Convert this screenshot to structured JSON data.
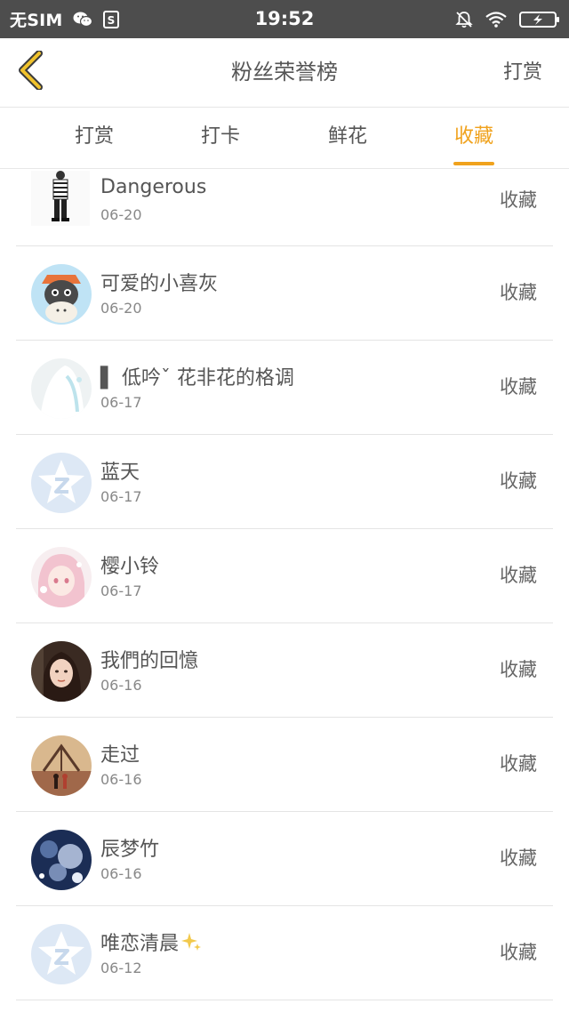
{
  "status_bar": {
    "carrier": "无SIM",
    "time": "19:52",
    "icons": [
      "wechat-icon",
      "s-app-icon",
      "mute-bell-icon",
      "wifi-icon",
      "battery-charging-icon"
    ]
  },
  "header": {
    "title": "粉丝荣誉榜",
    "back_icon": "chevron-left-icon",
    "action_label": "打赏"
  },
  "tabs": [
    {
      "label": "打赏",
      "active": false
    },
    {
      "label": "打卡",
      "active": false
    },
    {
      "label": "鲜花",
      "active": false
    },
    {
      "label": "收藏",
      "active": true
    }
  ],
  "accent_color": "#f0a21d",
  "list": [
    {
      "name": "Dangerous",
      "date": "06-20",
      "action": "收藏"
    },
    {
      "name": "可爱的小喜灰",
      "date": "06-20",
      "action": "收藏"
    },
    {
      "name": "▌ 低吟ˇ  花非花的格调",
      "date": "06-17",
      "action": "收藏"
    },
    {
      "name": "蓝天",
      "date": "06-17",
      "action": "收藏"
    },
    {
      "name": "樱小铃",
      "date": "06-17",
      "action": "收藏"
    },
    {
      "name": "我們的回憶",
      "date": "06-16",
      "action": "收藏"
    },
    {
      "name": "走过",
      "date": "06-16",
      "action": "收藏"
    },
    {
      "name": "辰梦竹",
      "date": "06-16",
      "action": "收藏"
    },
    {
      "name": "唯恋清晨",
      "date": "06-12",
      "action": "收藏"
    }
  ]
}
